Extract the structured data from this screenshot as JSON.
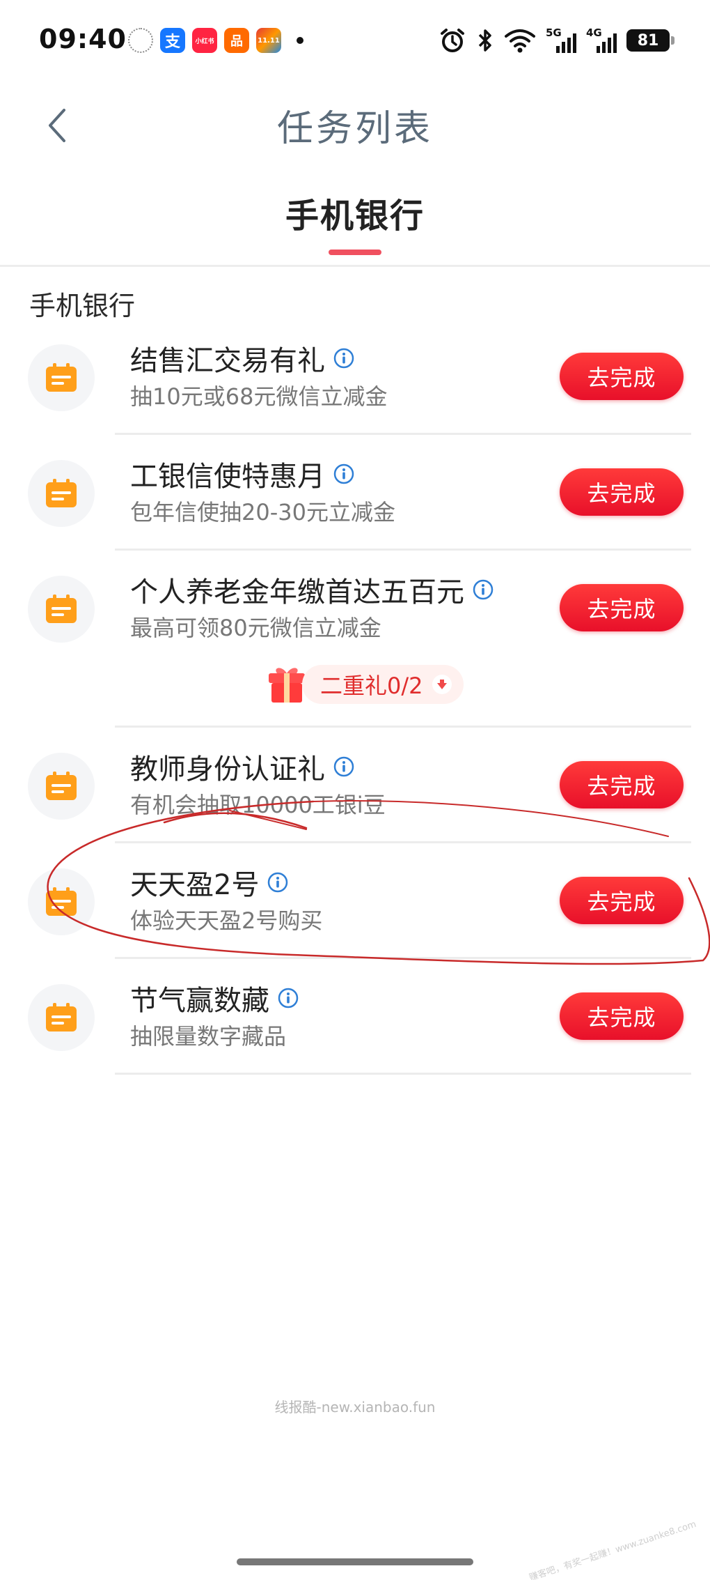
{
  "status_bar": {
    "time": "09:40",
    "apps": [
      {
        "icon": "clock-app-icon",
        "label": ""
      },
      {
        "icon": "alipay-app-icon",
        "label": "支"
      },
      {
        "icon": "xiaohongshu-app-icon",
        "label": "小红书"
      },
      {
        "icon": "taobao-app-icon",
        "label": "品"
      },
      {
        "icon": "multi-color-app-icon",
        "label": "11.11"
      }
    ],
    "network_5g": "5G",
    "network_4g": "4G",
    "battery": "81"
  },
  "header": {
    "title": "任务列表"
  },
  "tabs": [
    {
      "label": "手机银行",
      "active": true
    }
  ],
  "section": {
    "title": "手机银行"
  },
  "tasks": [
    {
      "name": "结售汇交易有礼",
      "desc": "抽10元或68元微信立减金",
      "button": "去完成"
    },
    {
      "name": "工银信使特惠月",
      "desc": "包年信使抽20-30元立减金",
      "button": "去完成"
    },
    {
      "name": "个人养老金年缴首达五百元",
      "desc": "最高可领80元微信立减金",
      "button": "去完成"
    },
    {
      "name": "教师身份认证礼",
      "desc": "有机会抽取10000工银i豆",
      "button": "去完成"
    },
    {
      "name": "天天盈2号",
      "desc": "体验天天盈2号购买",
      "button": "去完成"
    },
    {
      "name": "节气赢数藏",
      "desc": "抽限量数字藏品",
      "button": "去完成"
    }
  ],
  "gift": {
    "label": "二重礼0/2"
  },
  "watermark": "线报酷-new.xianbao.fun",
  "corner_watermark": "赚客吧，有奖一起赚！www.zuanke8.com",
  "colors": {
    "accent_red": "#e8102a",
    "task_icon_orange": "#ff9f1a",
    "info_blue": "#2f7fd6",
    "annotation_red": "#c82a2a"
  }
}
